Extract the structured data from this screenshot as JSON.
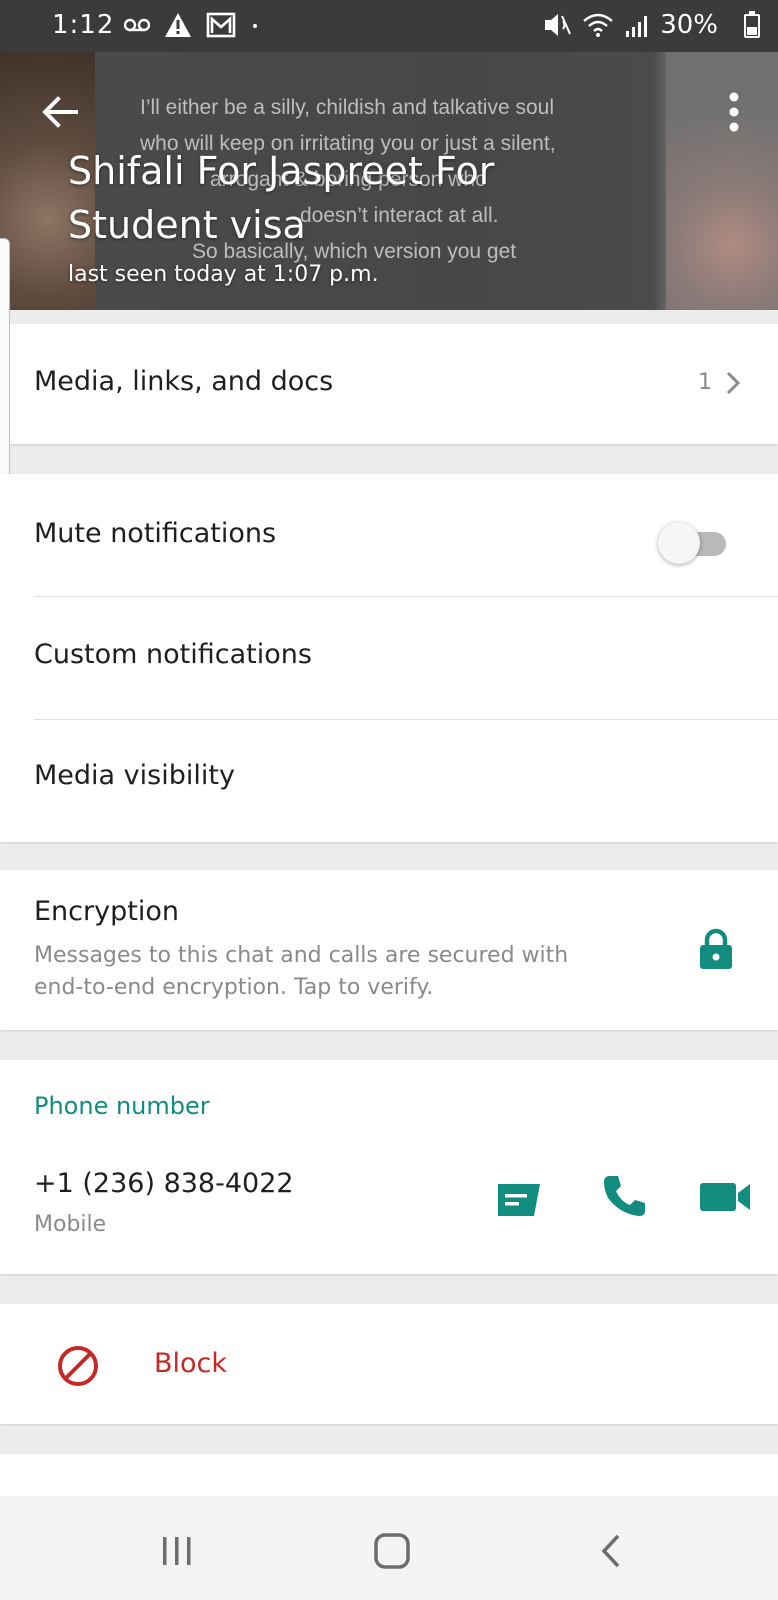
{
  "status_bar": {
    "time": "1:12",
    "battery": "30%",
    "left_icons": [
      "voicemail-icon",
      "warning-icon",
      "gmail-icon",
      "dot-icon"
    ],
    "right_icons": [
      "mute-vibrate-icon",
      "wifi-icon",
      "signal-icon",
      "battery-icon"
    ]
  },
  "header": {
    "contact_name": "Shifali For Jaspreet For Student visa",
    "last_seen": "last seen today at 1:07 p.m.",
    "background_quote": [
      "I’ll either be a silly, childish and talkative soul",
      "who will keep on irritating you or just a silent,",
      "arrogant & boring person who",
      "doesn’t interact at all.",
      "So basically, which version you get"
    ]
  },
  "media_section": {
    "label": "Media, links, and docs",
    "count": "1"
  },
  "notifications_section": {
    "mute_label": "Mute notifications",
    "mute_enabled": false,
    "custom_label": "Custom notifications",
    "media_visibility_label": "Media visibility"
  },
  "encryption_section": {
    "title": "Encryption",
    "description": "Messages to this chat and calls are secured with end-to-end encryption. Tap to verify."
  },
  "phone_section": {
    "header": "Phone number",
    "number": "+1 (236) 838-4022",
    "type": "Mobile"
  },
  "block_section": {
    "label": "Block"
  },
  "colors": {
    "accent": "#128c7e",
    "danger": "#c62828",
    "status_bar": "#3b3b3b"
  }
}
